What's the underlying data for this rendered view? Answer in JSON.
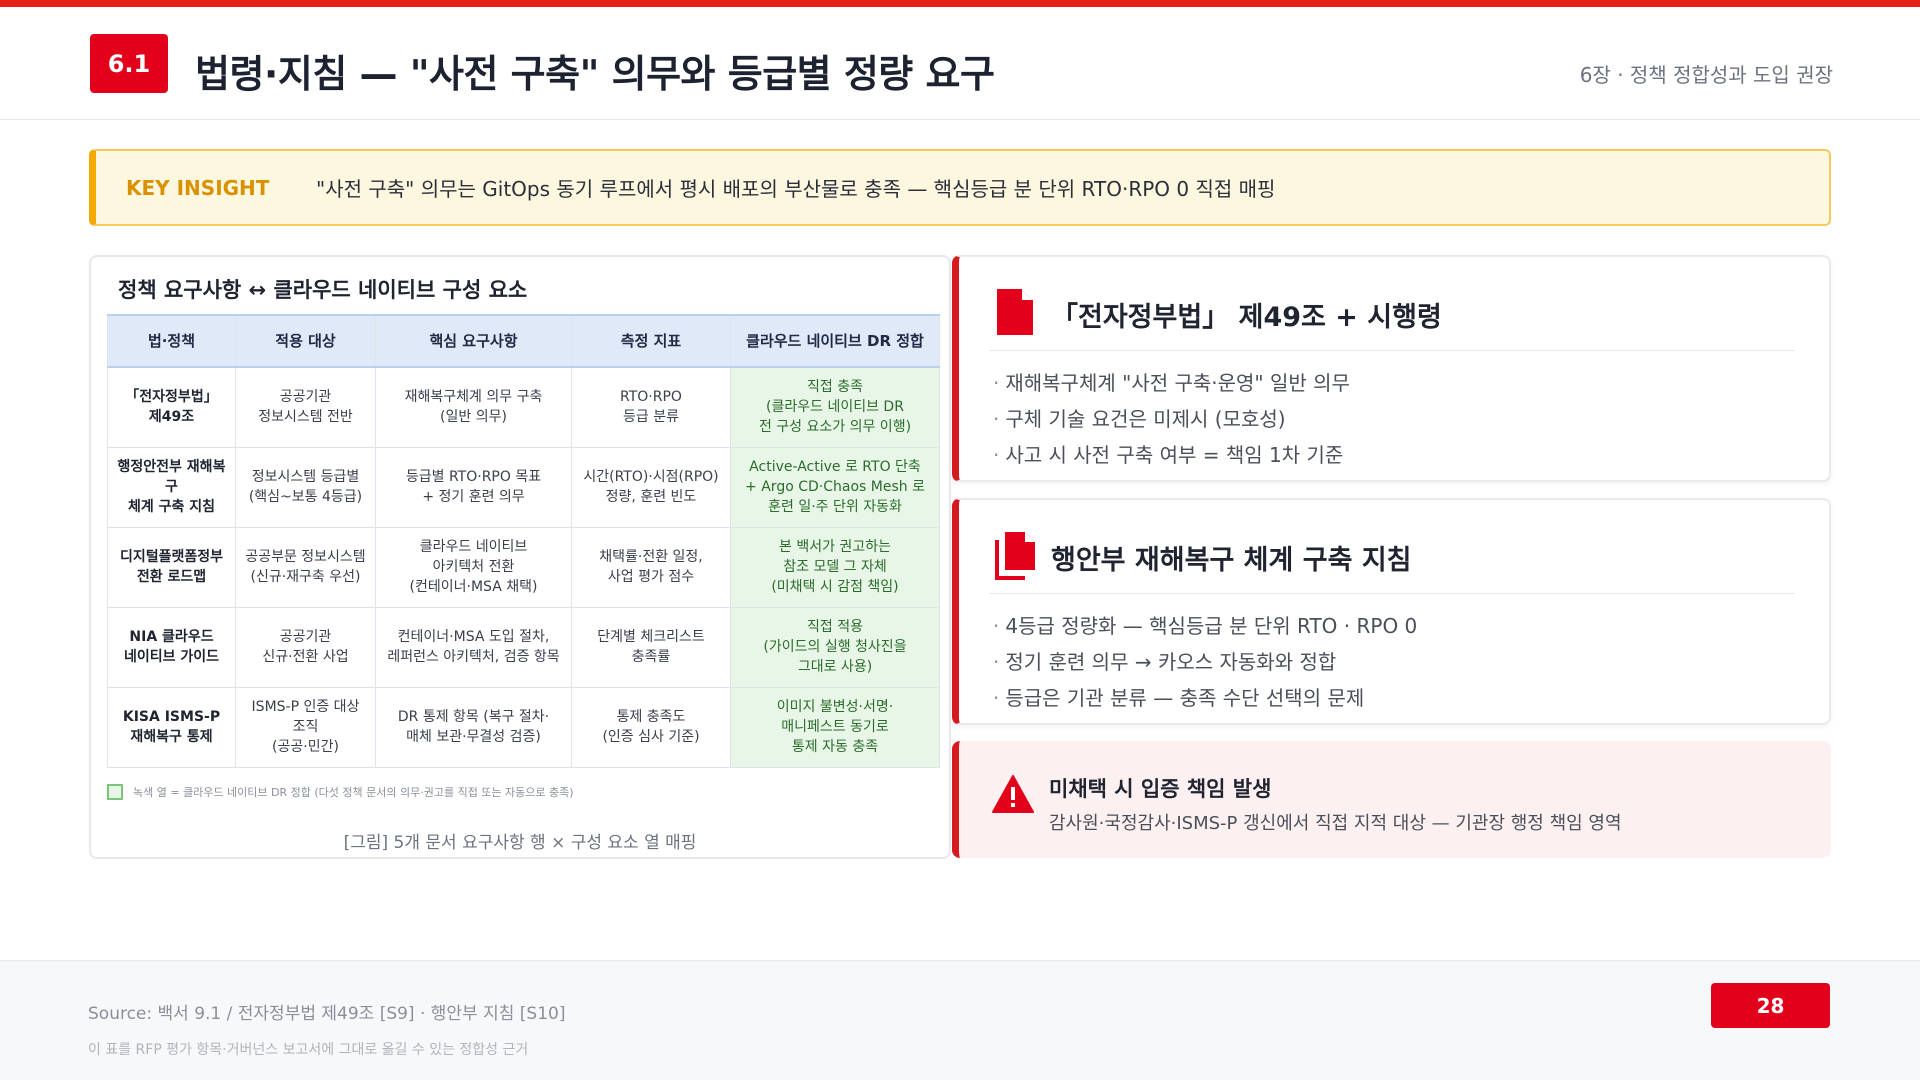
{
  "header": {
    "section_number": "6.1",
    "title": "법령·지침 — \"사전 구축\" 의무와 등급별 정량 요구",
    "chapter": "6장 · 정책 정합성과 도입 권장"
  },
  "insight": {
    "label": "KEY INSIGHT",
    "text": "\"사전 구축\" 의무는 GitOps 동기 루프에서 평시 배포의 부산물로 충족 — 핵심등급 분 단위 RTO·RPO 0 직접 매핑"
  },
  "table_card": {
    "title": "정책 요구사항 ↔ 클라우드 네이티브 구성 요소",
    "columns": [
      "법·정책",
      "적용 대상",
      "핵심 요구사항",
      "측정 지표",
      "클라우드 네이티브 DR 정합"
    ],
    "rows": [
      [
        "「전자정부법」\n제49조",
        "공공기관\n정보시스템 전반",
        "재해복구체계 의무 구축\n(일반 의무)",
        "RTO·RPO\n등급 분류",
        "직접 충족\n(클라우드 네이티브 DR\n전 구성 요소가 의무 이행)"
      ],
      [
        "행정안전부 재해복구\n체계 구축 지침",
        "정보시스템 등급별\n(핵심~보통 4등급)",
        "등급별 RTO·RPO 목표\n+ 정기 훈련 의무",
        "시간(RTO)·시점(RPO)\n정량, 훈련 빈도",
        "Active-Active 로 RTO 단축\n+ Argo CD·Chaos Mesh 로\n훈련 일·주 단위 자동화"
      ],
      [
        "디지털플랫폼정부\n전환 로드맵",
        "공공부문 정보시스템\n(신규·재구축 우선)",
        "클라우드 네이티브\n아키텍처 전환\n(컨테이너·MSA 채택)",
        "채택률·전환 일정,\n사업 평가 점수",
        "본 백서가 권고하는\n참조 모델 그 자체\n(미채택 시 감점 책임)"
      ],
      [
        "NIA 클라우드\n네이티브 가이드",
        "공공기관\n신규·전환 사업",
        "컨테이너·MSA 도입 절차,\n레퍼런스 아키텍처, 검증 항목",
        "단계별 체크리스트\n충족률",
        "직접 적용\n(가이드의 실행 청사진을\n그대로 사용)"
      ],
      [
        "KISA ISMS-P\n재해복구 통제",
        "ISMS-P 인증 대상\n조직\n(공공·민간)",
        "DR 통제 항목 (복구 절차·\n매체 보관·무결성 검증)",
        "통제 충족도\n(인증 심사 기준)",
        "이미지 불변성·서명·\n매니페스트 동기로\n통제 자동 충족"
      ]
    ],
    "legend": "녹색 열 = 클라우드 네이티브 DR 정합 (다섯 정책 문서의 의무·권고를 직접 또는 자동으로 충족)",
    "caption": "[그림] 5개 문서 요구사항 행 × 구성 요소 열 매핑"
  },
  "law_card": {
    "icon": "document-icon",
    "title": "「전자정부법」 제49조 + 시행령",
    "items": [
      "재해복구체계 \"사전 구축·운영\" 일반 의무",
      "구체 기술 요건은 미제시 (모호성)",
      "사고 시 사전 구축 여부 = 책임 1차 기준"
    ]
  },
  "guideline_card": {
    "icon": "documents-icon",
    "title": "행안부 재해복구 체계 구축 지침",
    "items": [
      "4등급 정량화 — 핵심등급 분 단위 RTO · RPO 0",
      "정기 훈련 의무 → 카오스 자동화와 정합",
      "등급은 기관 분류 — 충족 수단 선택의 문제"
    ]
  },
  "warning_card": {
    "icon": "warning-icon",
    "title": "미채택 시 입증 책임 발생",
    "text": "감사원·국정감사·ISMS-P 갱신에서 직접 지적 대상 — 기관장 행정 책임 영역"
  },
  "footer": {
    "source": "Source: 백서 9.1 / 전자정부법 제49조 [S9] · 행안부 지침 [S10]",
    "note": "이 표를 RFP 평가 항목·거버넌스 보고서에 그대로 옮길 수 있는 정합성 근거",
    "page_number": "28"
  },
  "colors": {
    "accent_red": "#e3001b",
    "insight_gold": "#f2a900",
    "match_green": "#e8f6e8",
    "header_blue": "#dfe9f8"
  }
}
